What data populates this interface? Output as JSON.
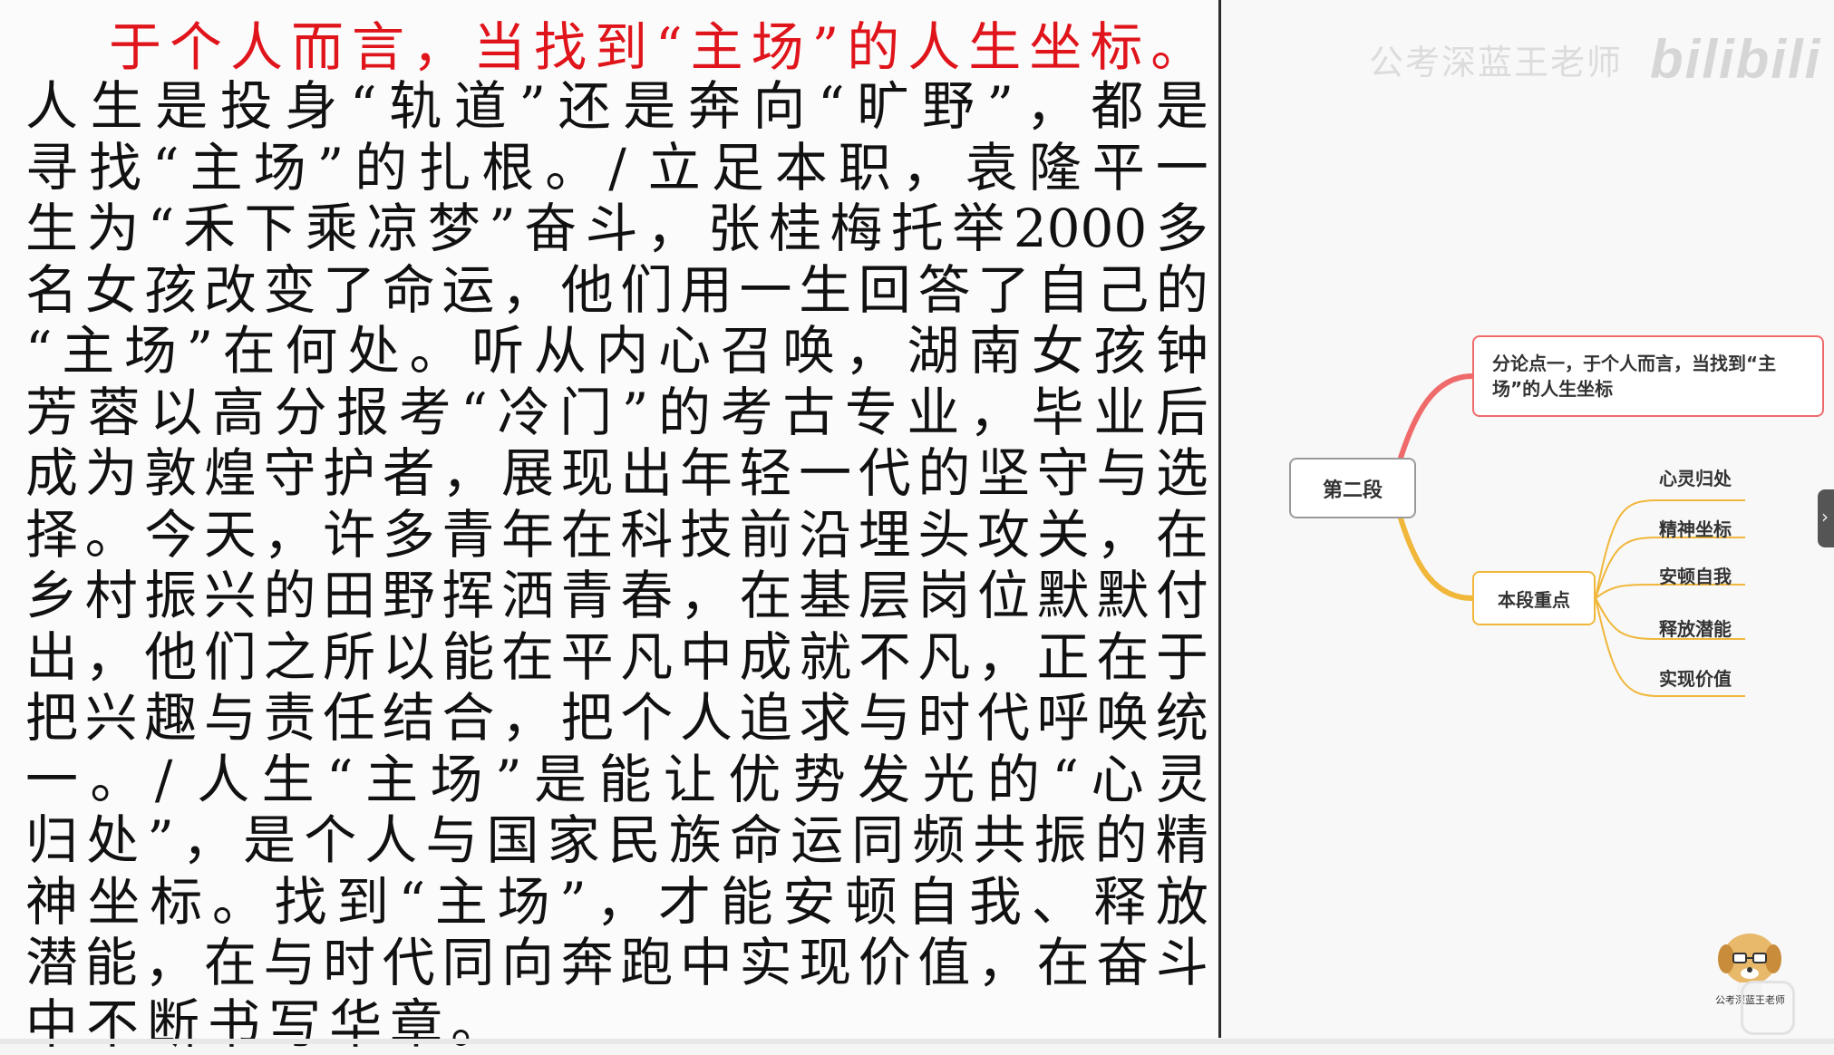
{
  "heading": "于个人而言，当找到“主场”的人生坐标。",
  "essay_lines": [
    "人生是投身“轨道”还是奔向“旷野”，都是",
    "寻找“主场”的扎根。/ 立足本职，袁隆平一",
    "生为“禾下乘凉梦”奋斗，张桂梅托举2000多",
    "名女孩改变了命运，他们用一生回答了自己的",
    "“主场”在何处。听从内心召唤，湖南女孩钟",
    "芳蓉以高分报考“冷门”的考古专业，毕业后",
    "成为敦煌守护者，展现出年轻一代的坚守与选",
    "择。今天，许多青年在科技前沿埋头攻关，在",
    "乡村振兴的田野挥洒青春，在基层岗位默默付",
    "出，他们之所以能在平凡中成就不凡，正在于",
    "把兴趣与责任结合，把个人追求与时代呼唤统",
    "一。/ 人生“主场”是能让优势发光的“心灵",
    "归处”，是个人与国家民族命运同频共振的精",
    "神坐标。找到“主场”，才能安顿自我、释放",
    "潜能，在与时代同向奔跑中实现价值，在奋斗",
    "中不断书写华章。"
  ],
  "watermark": {
    "text": "公考深蓝王老师",
    "logo": "bilibili"
  },
  "mindmap": {
    "root": "第二段",
    "point": {
      "line1": "分论点一，于个人而言，当找到“主",
      "line2": "场”的人生坐标"
    },
    "focus": "本段重点",
    "leaves": [
      "心灵归处",
      "精神坐标",
      "安顿自我",
      "释放潜能",
      "实现价值"
    ],
    "colors": {
      "point_branch": "#ef6b6b",
      "focus_branch": "#f0b73a"
    }
  },
  "mascot_label": "公考深蓝王老师"
}
